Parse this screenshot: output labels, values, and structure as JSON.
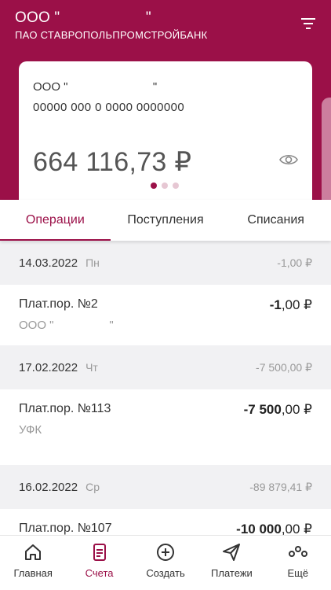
{
  "header": {
    "org_name": "ООО \"                    \"",
    "bank_name": "ПАО СТАВРОПОЛЬПРОМСТРОЙБАНК"
  },
  "card": {
    "org_name": "ООО \"                          \"",
    "account_number": "00000 000 0 0000 0000000",
    "balance": "664 116,73 ₽"
  },
  "tabs": [
    "Операции",
    "Поступления",
    "Списания"
  ],
  "groups": [
    {
      "date": "14.03.2022",
      "weekday": "Пн",
      "total": "-1,00 ₽",
      "operations": [
        {
          "title": "Плат.пор. №2",
          "subtitle": "ООО \"                 \"",
          "amount_int": "-1",
          "amount_frac": ",00 ₽"
        }
      ]
    },
    {
      "date": "17.02.2022",
      "weekday": "Чт",
      "total": "-7 500,00 ₽",
      "operations": [
        {
          "title": "Плат.пор. №113",
          "subtitle": "УФК",
          "amount_int": "-7 500",
          "amount_frac": ",00 ₽"
        }
      ]
    },
    {
      "date": "16.02.2022",
      "weekday": "Ср",
      "total": "-89 879,41 ₽",
      "operations": [
        {
          "title": "Плат.пор. №107",
          "subtitle": "",
          "amount_int": "-10 000",
          "amount_frac": ",00 ₽"
        }
      ]
    }
  ],
  "bottom_nav": [
    {
      "label": "Главная",
      "icon": "home-icon"
    },
    {
      "label": "Счета",
      "icon": "document-icon"
    },
    {
      "label": "Создать",
      "icon": "plus-circle-icon"
    },
    {
      "label": "Платежи",
      "icon": "send-icon"
    },
    {
      "label": "Ещё",
      "icon": "more-icon"
    }
  ],
  "colors": {
    "brand": "#9b1048",
    "muted": "#999999"
  }
}
